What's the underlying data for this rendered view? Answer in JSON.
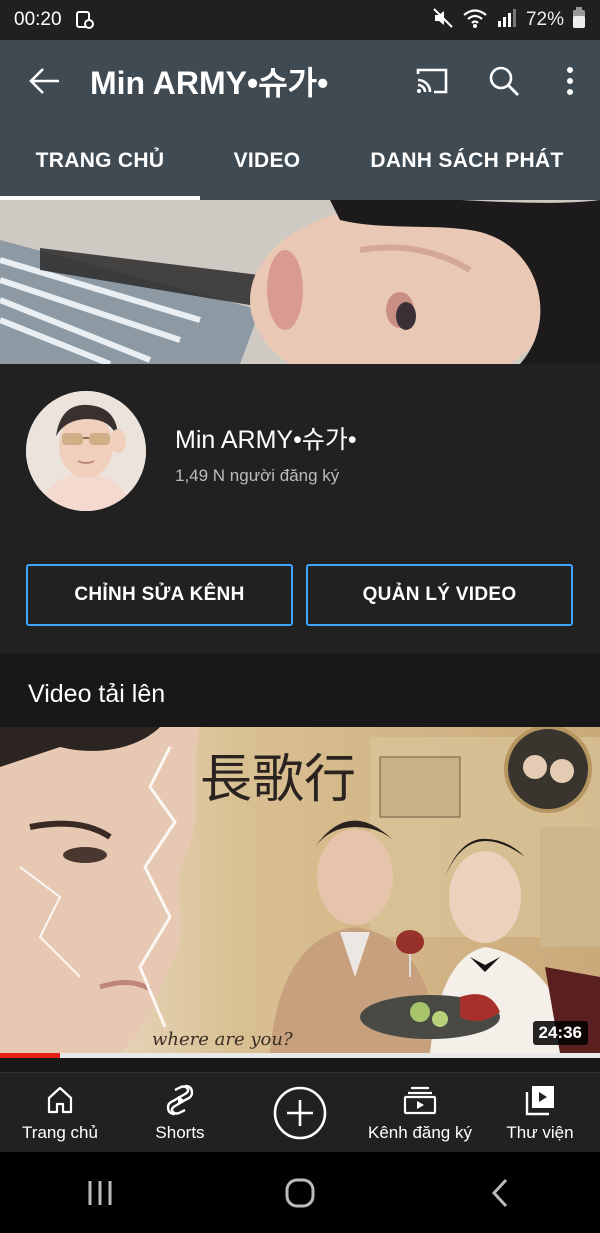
{
  "status_bar": {
    "time": "00:20",
    "battery": "72%"
  },
  "app_bar": {
    "title": "Min ARMY•슈가•"
  },
  "tabs": [
    {
      "label": "TRANG CHỦ",
      "active": true
    },
    {
      "label": "VIDEO",
      "active": false
    },
    {
      "label": "DANH SÁCH PHÁT",
      "active": false
    }
  ],
  "channel": {
    "name": "Min ARMY•슈가•",
    "subscribers": "1,49 N người đăng ký",
    "edit_button": "CHỈNH SỬA KÊNH",
    "manage_button": "QUẢN LÝ VIDEO"
  },
  "uploads": {
    "title": "Video tải lên",
    "video": {
      "duration": "24:36",
      "watched_fraction": 0.1,
      "overlay_text": "where are you?",
      "chinese_text": "長歌行"
    }
  },
  "bottom_nav": [
    {
      "label": "Trang chủ",
      "icon": "home-icon"
    },
    {
      "label": "Shorts",
      "icon": "shorts-icon"
    },
    {
      "label": "",
      "icon": "create-icon"
    },
    {
      "label": "Kênh đăng ký",
      "icon": "subscriptions-icon"
    },
    {
      "label": "Thư viện",
      "icon": "library-icon"
    }
  ],
  "colors": {
    "app_bar": "#3f4a52",
    "accent_blue": "#3ea6ff",
    "progress_red": "#e62117",
    "background": "#181818"
  }
}
